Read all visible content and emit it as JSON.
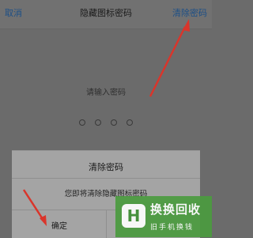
{
  "header": {
    "cancel_label": "取消",
    "title": "隐藏图标密码",
    "clear_label": "清除密码"
  },
  "main": {
    "prompt": "请输入密码",
    "digits_total": 4,
    "digits_entered": 0
  },
  "dialog": {
    "title": "清除密码",
    "message": "您即将清除隐藏图标密码",
    "confirm_label": "确定"
  },
  "watermark": {
    "logo_text": "H",
    "brand": "换换回收",
    "tagline": "旧手机换钱"
  },
  "colors": {
    "annotation_arrow": "#d9352b",
    "watermark_bg": "#4b9b3f",
    "link_blue": "#1d4f86"
  }
}
